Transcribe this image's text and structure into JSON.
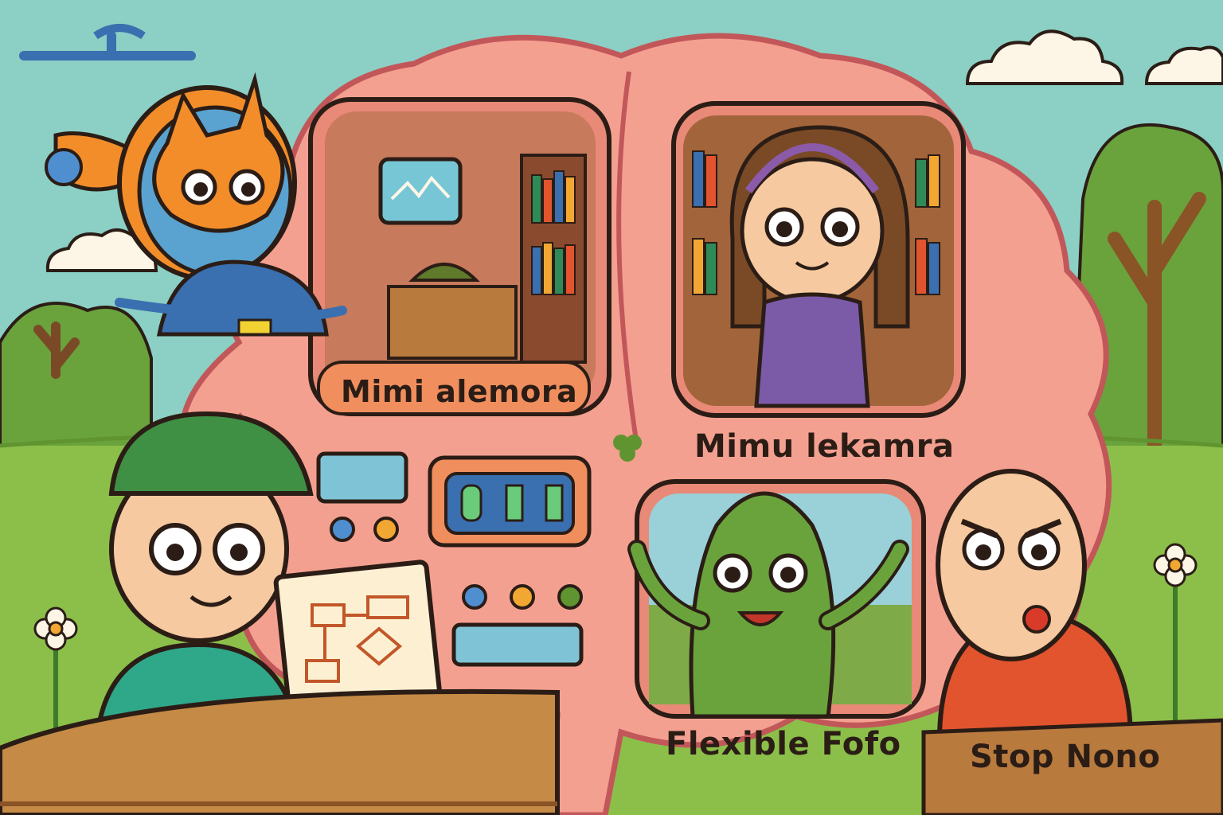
{
  "labels": {
    "mimi_alemora": "Mimi alemora",
    "mimu_lekamra": "Mimu lekamra",
    "flexible_fofo": "Flexible Fofo",
    "stop_nono": "Stop Nono"
  },
  "colors": {
    "sky": "#8ccfc4",
    "grass": "#8cbf4a",
    "brain": "#f4a090",
    "brain_outline": "#c2575a",
    "wood": "#b97a3e",
    "outline": "#2b1d16"
  }
}
